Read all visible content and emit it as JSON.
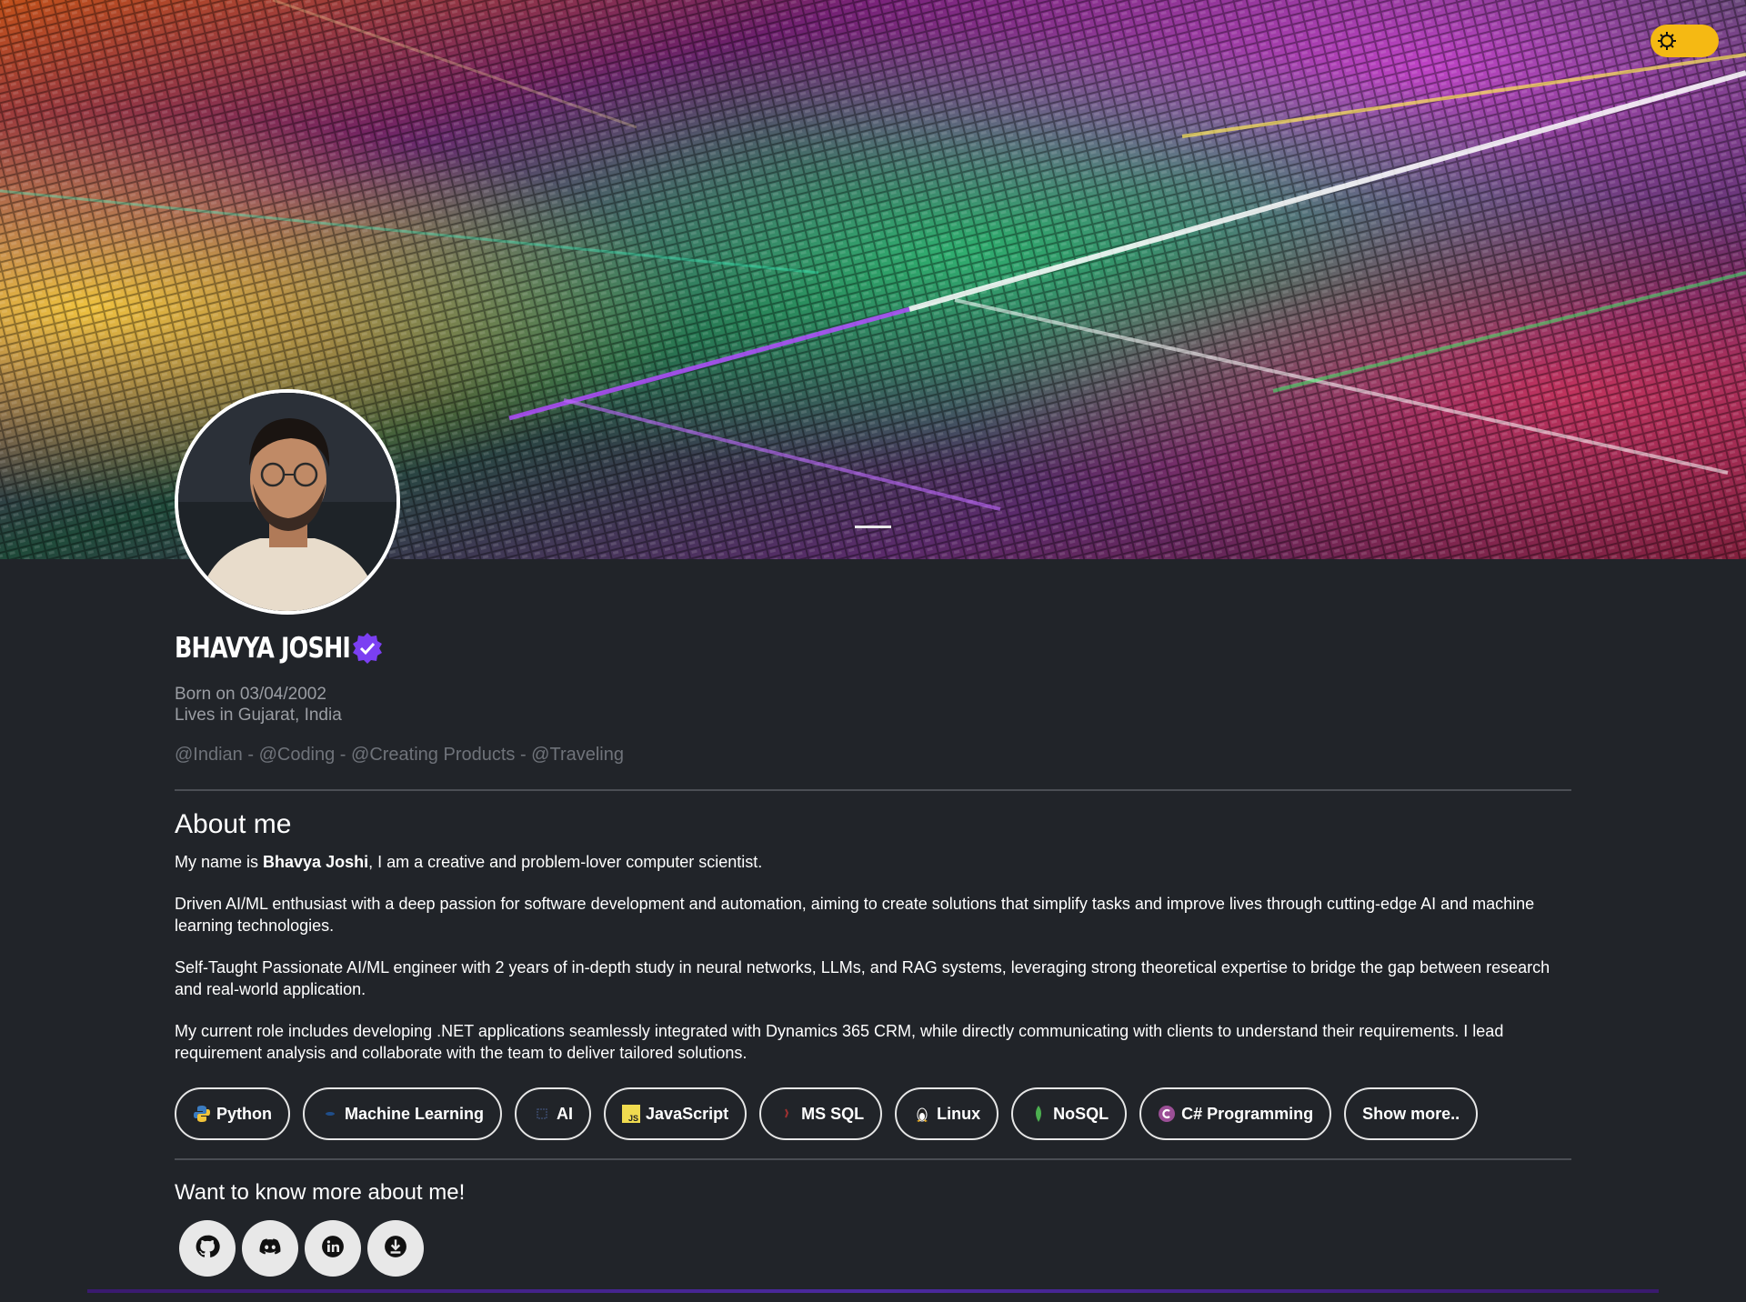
{
  "profile": {
    "name": "BHAVYA JOSHI",
    "born": "Born on 03/04/2002",
    "location": "Lives in Gujarat, India",
    "tags": "@Indian - @Coding - @Creating Products - @Traveling"
  },
  "about": {
    "title": "About me",
    "intro_prefix": "My name is ",
    "intro_name": "Bhavya Joshi",
    "intro_suffix": ", I am a creative and problem-lover computer scientist.",
    "p2": "Driven AI/ML enthusiast with a deep passion for software development and automation, aiming to create solutions that simplify tasks and improve lives through cutting-edge AI and machine learning technologies.",
    "p3": "Self-Taught Passionate AI/ML engineer with 2 years of in-depth study in neural networks, LLMs, and RAG systems, leveraging strong theoretical expertise to bridge the gap between research and real-world application.",
    "p4": "My current role includes developing .NET applications seamlessly integrated with Dynamics 365 CRM, while directly communicating with clients to understand their requirements. I lead requirement analysis and collaborate with the team to deliver tailored solutions."
  },
  "skills": [
    {
      "label": "Python",
      "icon": "python-icon"
    },
    {
      "label": "Machine Learning",
      "icon": "ml-icon"
    },
    {
      "label": "AI",
      "icon": "ai-icon"
    },
    {
      "label": "JavaScript",
      "icon": "javascript-icon"
    },
    {
      "label": "MS SQL",
      "icon": "mssql-icon"
    },
    {
      "label": "Linux",
      "icon": "linux-icon"
    },
    {
      "label": "NoSQL",
      "icon": "nosql-icon"
    },
    {
      "label": "C# Programming",
      "icon": "csharp-icon"
    }
  ],
  "show_more": "Show more..",
  "contact": {
    "title": "Want to know more about me!",
    "links": [
      "github-icon",
      "discord-icon",
      "linkedin-icon",
      "download-icon"
    ]
  },
  "colors": {
    "background": "#212429",
    "toggle": "#f5b913",
    "verified": "#7b3ff2",
    "muted_text": "#9a9da3"
  }
}
